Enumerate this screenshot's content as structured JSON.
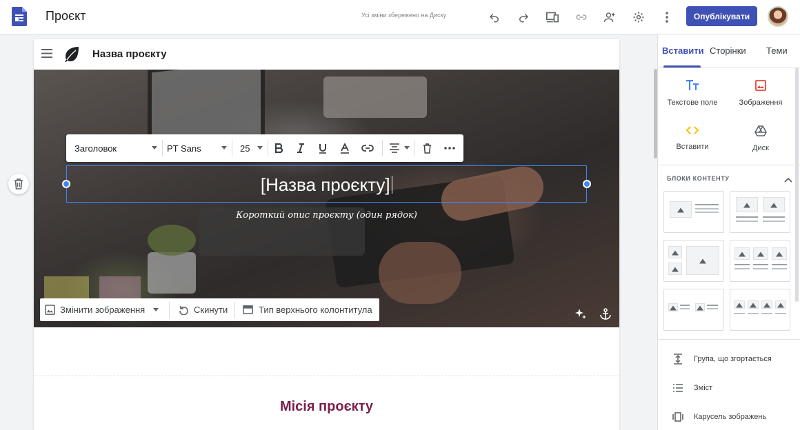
{
  "app": {
    "doc_title": "Проєкт",
    "save_status": "Усі зміни збережено на Диску",
    "publish_label": "Опублікувати"
  },
  "site": {
    "name": "Назва проєкту",
    "hero_title": "[Назва проєкту]",
    "hero_subtitle": "Короткий опис проєкту (один рядок)",
    "mission_title": "Місія проєкту"
  },
  "format_toolbar": {
    "style": "Заголовок",
    "font": "PT Sans",
    "size": "25"
  },
  "image_toolbar": {
    "change_image": "Змінити зображення",
    "reset": "Скинути",
    "header_type": "Тип верхнього колонтитула"
  },
  "panel": {
    "tabs": [
      "Вставити",
      "Сторінки",
      "Теми"
    ],
    "insert_items": [
      "Текстове поле",
      "Зображення",
      "Вставити",
      "Диск"
    ],
    "content_blocks_title": "БЛОКИ КОНТЕНТУ",
    "list_items": [
      "Група, що згортається",
      "Зміст",
      "Карусель зображень"
    ]
  },
  "colors": {
    "accent": "#3f51b5",
    "selection": "#4285f4",
    "mission_title": "#7b1f4b",
    "drive_yellow": "#fbbc04",
    "image_red": "#ea4335"
  }
}
